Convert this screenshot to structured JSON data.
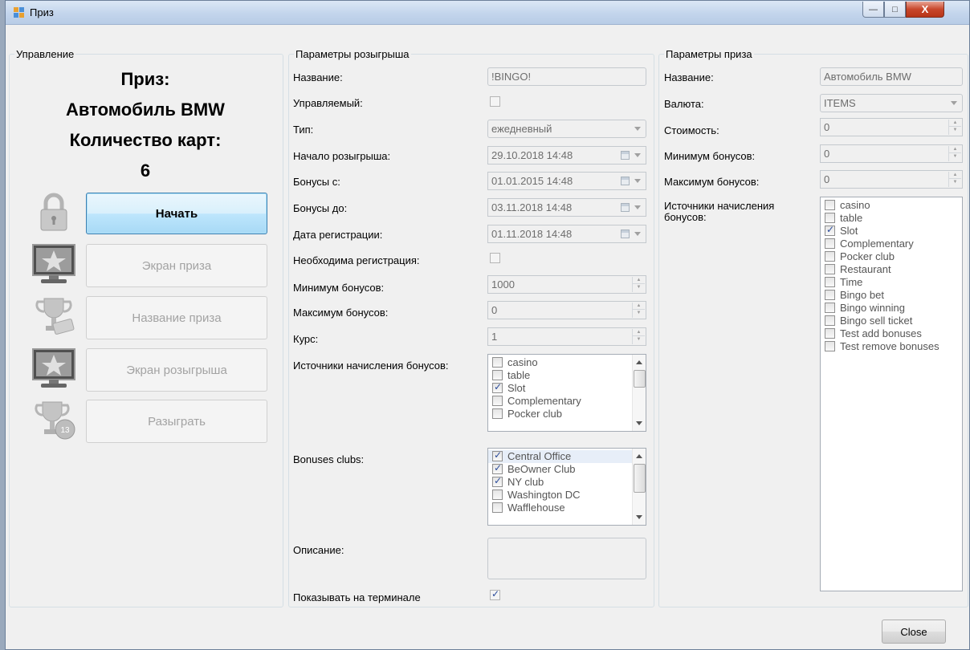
{
  "window": {
    "title": "Приз",
    "buttons": {
      "minimize": "—",
      "maximize": "□",
      "close": "X"
    }
  },
  "control": {
    "group_title": "Управление",
    "prize_label": "Приз:",
    "prize_name": "Автомобиль BMW",
    "cards_label": "Количество карт:",
    "cards_count": "6",
    "buttons": {
      "start": "Начать",
      "prize_screen": "Экран приза",
      "prize_name": "Название приза",
      "draw_screen": "Экран розыгрыша",
      "draw": "Разыграть"
    }
  },
  "draw_params": {
    "group_title": "Параметры розыгрыша",
    "name_label": "Название:",
    "name_value": "!BINGO!",
    "managed_label": "Управляемый:",
    "type_label": "Тип:",
    "type_value": "ежедневный",
    "start_label": "Начало розыгрыша:",
    "start_value": "29.10.2018 14:48",
    "bonus_from_label": "Бонусы с:",
    "bonus_from_value": "01.01.2015 14:48",
    "bonus_to_label": "Бонусы до:",
    "bonus_to_value": "03.11.2018 14:48",
    "reg_date_label": "Дата регистрации:",
    "reg_date_value": "01.11.2018 14:48",
    "reg_required_label": "Необходима регистрация:",
    "min_bonus_label": "Минимум бонусов:",
    "min_bonus_value": "1000",
    "max_bonus_label": "Максимум бонусов:",
    "max_bonus_value": "0",
    "rate_label": "Курс:",
    "rate_value": "1",
    "sources_label": "Источники начисления бонусов:",
    "sources": [
      {
        "label": "casino",
        "checked": false
      },
      {
        "label": "table",
        "checked": false
      },
      {
        "label": "Slot",
        "checked": true
      },
      {
        "label": "Complementary",
        "checked": false
      },
      {
        "label": "Pocker club",
        "checked": false
      }
    ],
    "clubs_label": "Bonuses clubs:",
    "clubs": [
      {
        "label": "Central Office",
        "checked": true
      },
      {
        "label": "BeOwner Club",
        "checked": true
      },
      {
        "label": "NY club",
        "checked": true
      },
      {
        "label": "Washington DC",
        "checked": false
      },
      {
        "label": "Wafflehouse",
        "checked": false
      }
    ],
    "description_label": "Описание:",
    "description_value": "",
    "show_terminal_label": "Показывать на терминале"
  },
  "prize_params": {
    "group_title": "Параметры приза",
    "name_label": "Название:",
    "name_value": "Автомобиль BMW",
    "currency_label": "Валюта:",
    "currency_value": "ITEMS",
    "cost_label": "Стоимость:",
    "cost_value": "0",
    "min_bonus_label": "Минимум бонусов:",
    "min_bonus_value": "0",
    "max_bonus_label": "Максимум бонусов:",
    "max_bonus_value": "0",
    "sources_label": "Источники начисления бонусов:",
    "sources": [
      {
        "label": "casino",
        "checked": false
      },
      {
        "label": "table",
        "checked": false
      },
      {
        "label": "Slot",
        "checked": true
      },
      {
        "label": "Complementary",
        "checked": false
      },
      {
        "label": "Pocker club",
        "checked": false
      },
      {
        "label": "Restaurant",
        "checked": false
      },
      {
        "label": "Time",
        "checked": false
      },
      {
        "label": "Bingo bet",
        "checked": false
      },
      {
        "label": "Bingo winning",
        "checked": false
      },
      {
        "label": "Bingo sell ticket",
        "checked": false
      },
      {
        "label": "Test add bonuses",
        "checked": false
      },
      {
        "label": "Test remove bonuses",
        "checked": false
      }
    ]
  },
  "footer": {
    "close_label": "Close"
  }
}
